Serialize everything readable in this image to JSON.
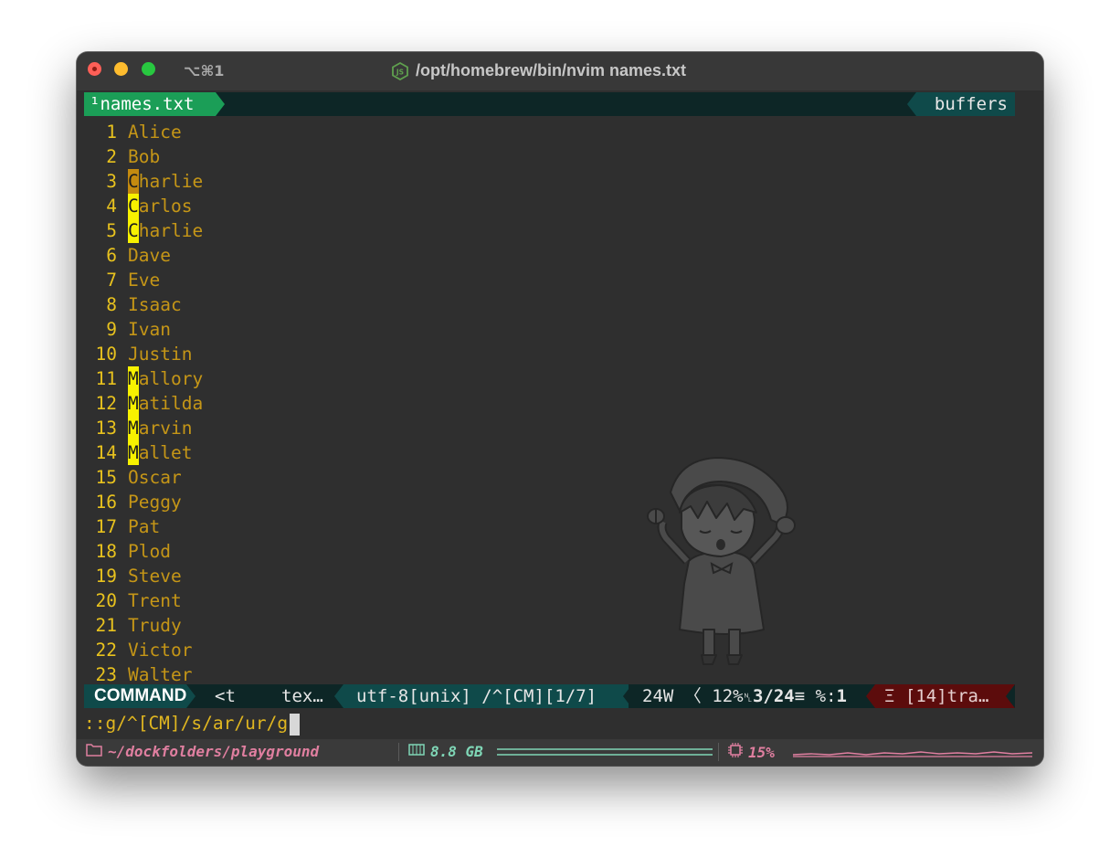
{
  "window": {
    "shortcut": "⌥⌘1",
    "title": "/opt/homebrew/bin/nvim names.txt",
    "title_icon": "nodejs-icon"
  },
  "tabline": {
    "active_tab": "¹names.txt",
    "right_label": "buffers"
  },
  "editor": {
    "lines": [
      {
        "n": "1",
        "text": "Alice",
        "hl": ""
      },
      {
        "n": "2",
        "text": "Bob",
        "hl": ""
      },
      {
        "n": "3",
        "text": "Charlie",
        "hl": "C",
        "current": true
      },
      {
        "n": "4",
        "text": "Carlos",
        "hl": "C"
      },
      {
        "n": "5",
        "text": "Charlie",
        "hl": "C"
      },
      {
        "n": "6",
        "text": "Dave",
        "hl": ""
      },
      {
        "n": "7",
        "text": "Eve",
        "hl": ""
      },
      {
        "n": "8",
        "text": "Isaac",
        "hl": ""
      },
      {
        "n": "9",
        "text": "Ivan",
        "hl": ""
      },
      {
        "n": "10",
        "text": "Justin",
        "hl": ""
      },
      {
        "n": "11",
        "text": "Mallory",
        "hl": "M"
      },
      {
        "n": "12",
        "text": "Matilda",
        "hl": "M"
      },
      {
        "n": "13",
        "text": "Marvin",
        "hl": "M"
      },
      {
        "n": "14",
        "text": "Mallet",
        "hl": "M"
      },
      {
        "n": "15",
        "text": "Oscar",
        "hl": ""
      },
      {
        "n": "16",
        "text": "Peggy",
        "hl": ""
      },
      {
        "n": "17",
        "text": "Pat",
        "hl": ""
      },
      {
        "n": "18",
        "text": "Plod",
        "hl": ""
      },
      {
        "n": "19",
        "text": "Steve",
        "hl": ""
      },
      {
        "n": "20",
        "text": "Trent",
        "hl": ""
      },
      {
        "n": "21",
        "text": "Trudy",
        "hl": ""
      },
      {
        "n": "22",
        "text": "Victor",
        "hl": ""
      },
      {
        "n": "23",
        "text": "Walter",
        "hl": ""
      }
    ]
  },
  "statusline": {
    "mode": "COMMAND",
    "file": "<t",
    "filetype": "tex…",
    "encoding": "utf-8[unix] /^[CM][1/7]",
    "words": "24W",
    "percent": "12%",
    "line_pos": "3/24",
    "col_pos": "1",
    "warnings": "Ξ [14]tra…"
  },
  "cmdline": {
    "text": "::g/^[CM]/s/ar/ur/g"
  },
  "bottombar": {
    "path": "~/dockfolders/playground",
    "memory": "8.8 GB",
    "cpu": "15%"
  },
  "colors": {
    "line_number": "#e8c21e",
    "text": "#c59617",
    "search_highlight": "#f7f100",
    "current_match": "#c48a0f",
    "tab_active": "#1b9e57",
    "status_dark": "#0d2626",
    "status_mid": "#0f4a4a",
    "status_warn": "#5c0c0c"
  }
}
